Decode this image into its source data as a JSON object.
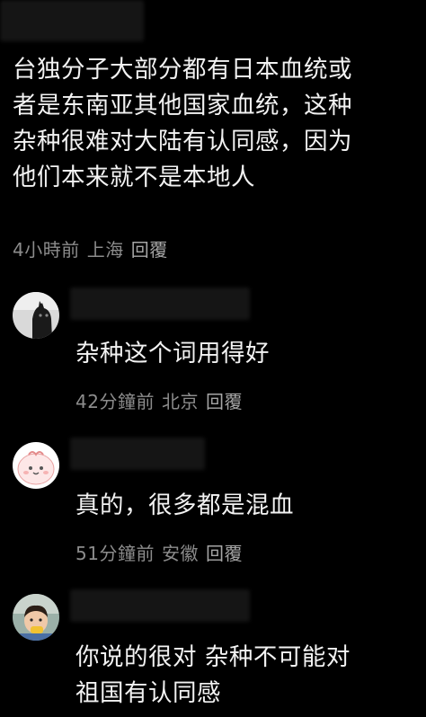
{
  "main_comment": {
    "text_lines": [
      "台独分子大部分都有日本血统或",
      "者是东南亚其他国家血统，这种",
      "杂种很难对大陆有认同感，因为",
      "他们本来就不是本地人"
    ],
    "time": "4小時前",
    "location": "上海",
    "reply_label": "回覆"
  },
  "replies": [
    {
      "avatar": "cat-avatar-icon",
      "text_lines": [
        "杂种这个词用得好"
      ],
      "time": "42分鐘前",
      "location": "北京",
      "reply_label": "回覆"
    },
    {
      "avatar": "pink-cartoon-avatar-icon",
      "text_lines": [
        "真的，很多都是混血"
      ],
      "time": "51分鐘前",
      "location": "安徽",
      "reply_label": "回覆"
    },
    {
      "avatar": "child-photo-avatar-icon",
      "text_lines": [
        "你说的很对 杂种不可能对",
        "祖国有认同感"
      ]
    }
  ],
  "colors": {
    "background": "#000000",
    "text": "#f2f2f2",
    "meta": "#8c8c8c"
  }
}
